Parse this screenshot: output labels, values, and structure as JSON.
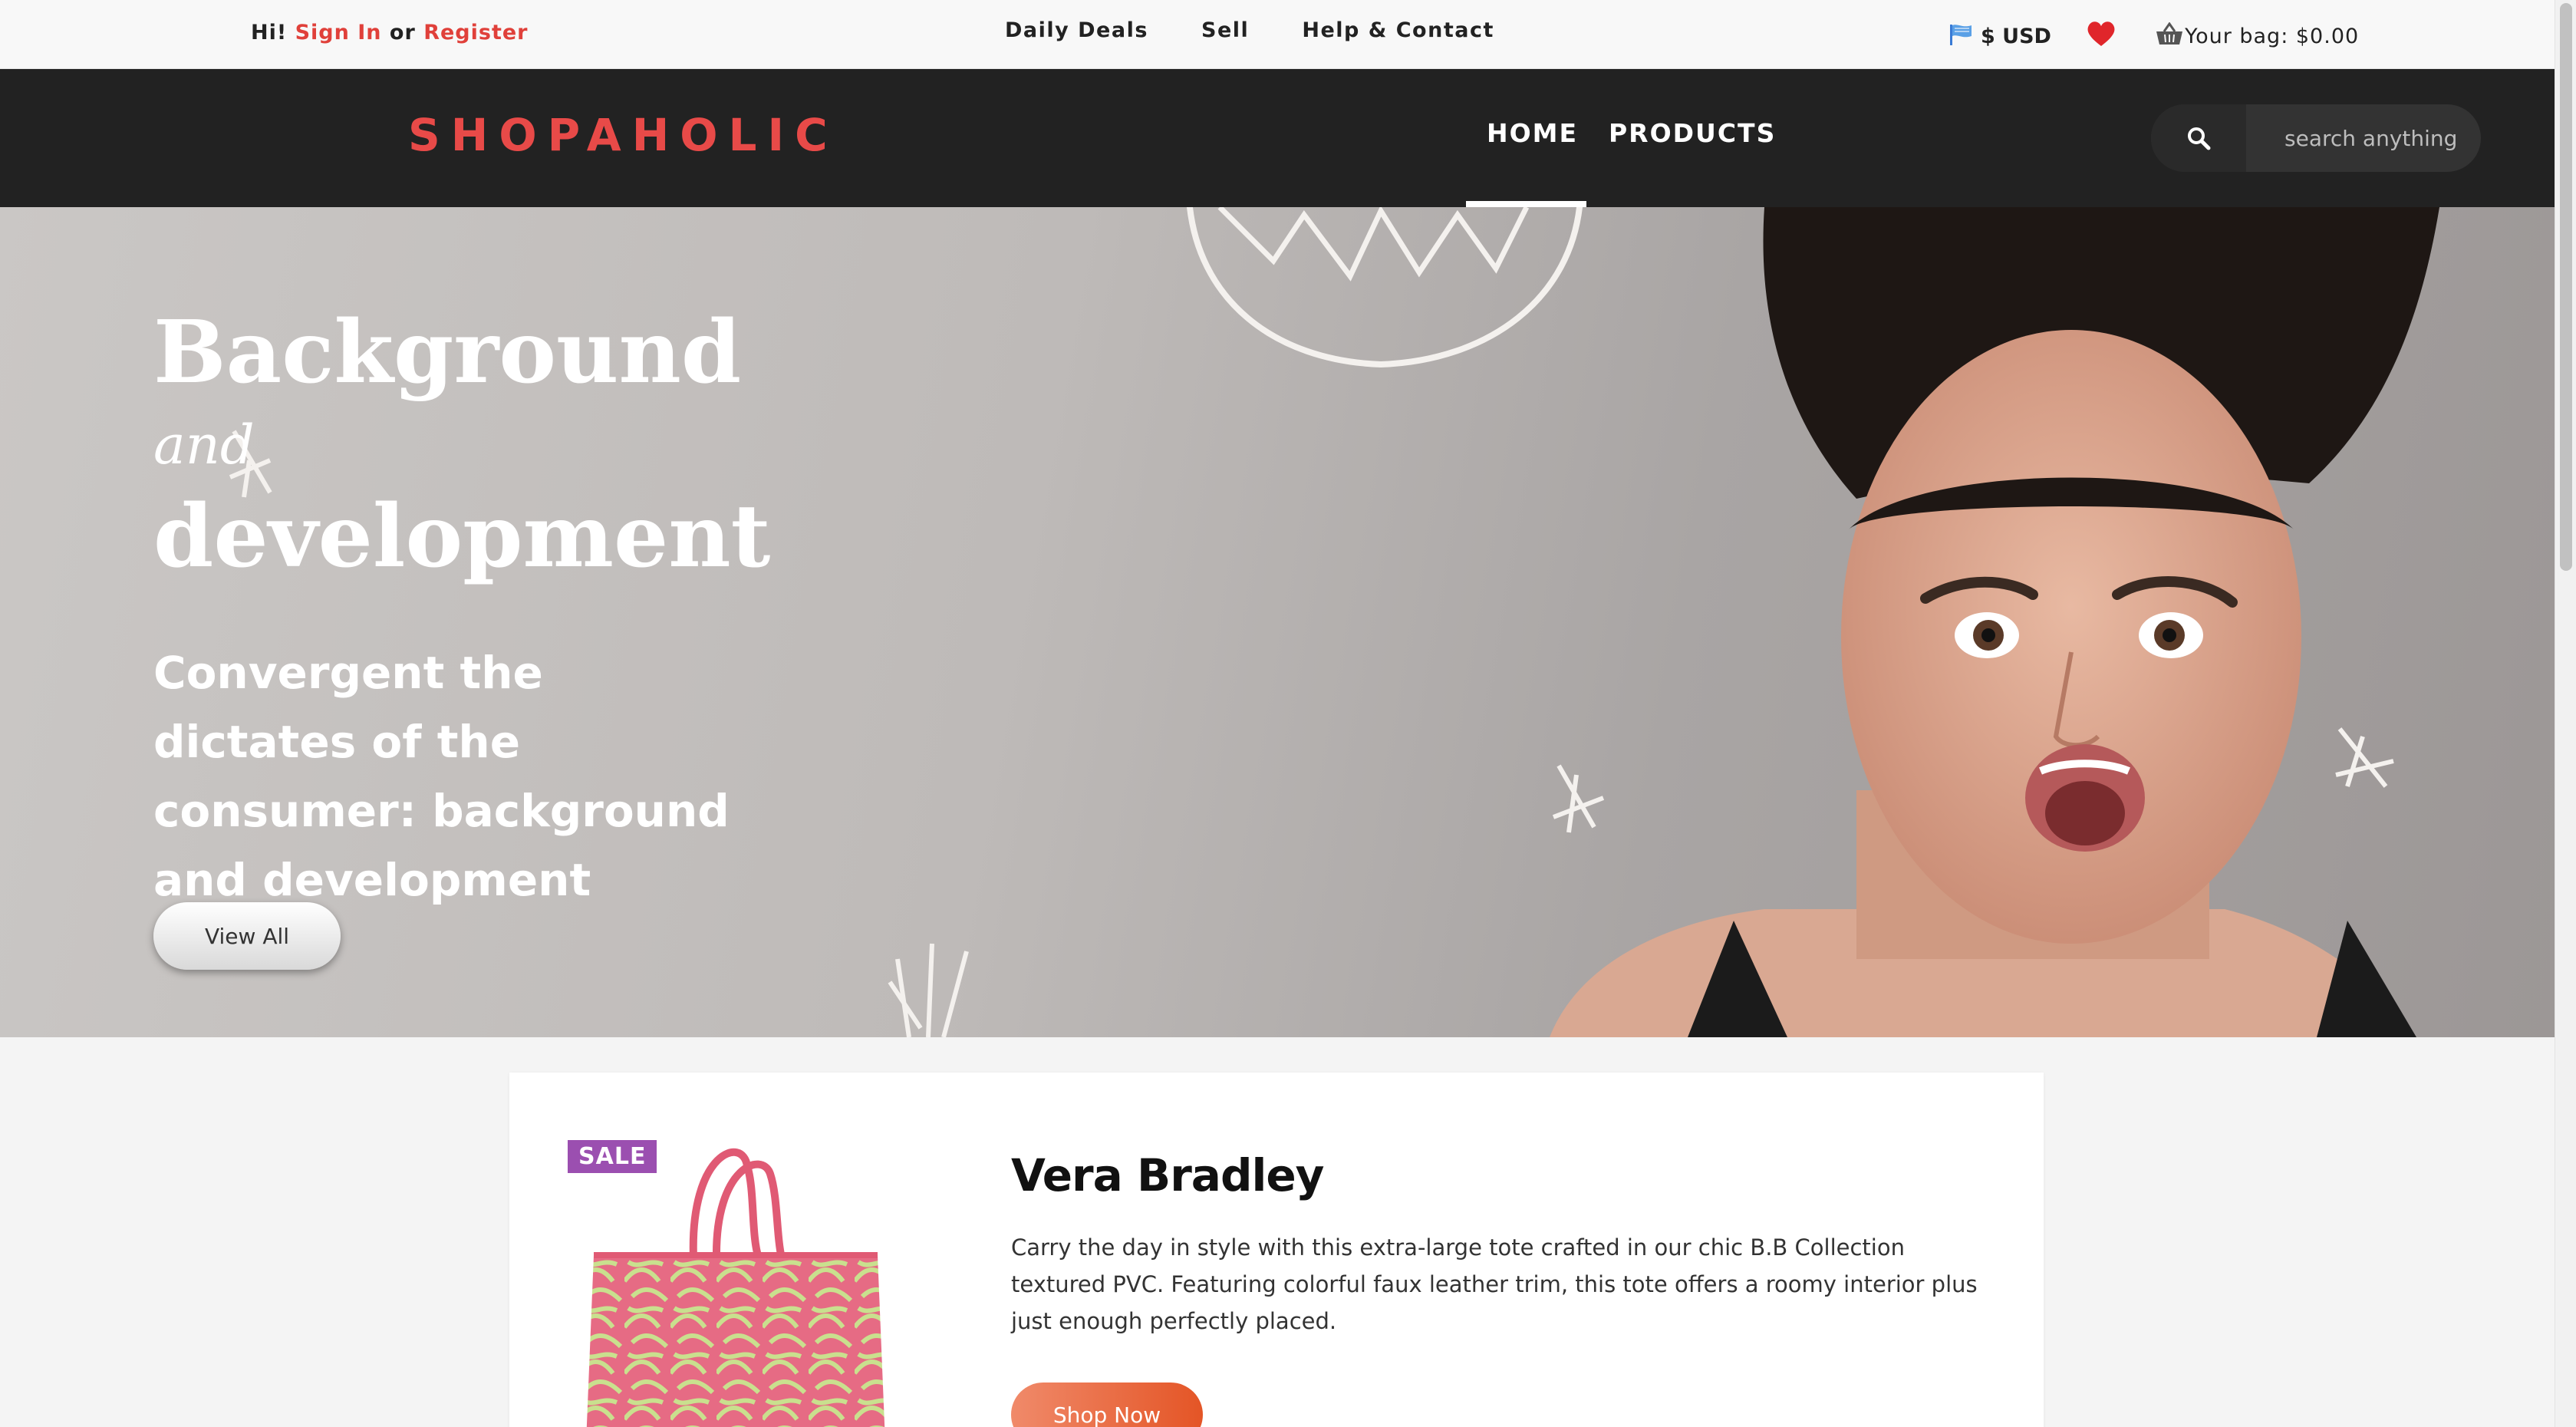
{
  "topbar": {
    "greeting_prefix": "Hi!",
    "sign_in": "Sign In",
    "or": "or",
    "register": "Register",
    "links": [
      "Daily Deals",
      "Sell",
      "Help & Contact"
    ],
    "currency": "$ USD",
    "bag": "Your bag: $0.00"
  },
  "nav": {
    "logo": "SHOPAHOLIC",
    "items": [
      "HOME",
      "PRODUCTS"
    ],
    "active": "HOME",
    "search_placeholder": "search anything"
  },
  "hero": {
    "title_line1": "Background",
    "title_and": "and",
    "title_line2": "development",
    "subtitle": "Convergent the dictates of the consumer: background and development",
    "button": "View All"
  },
  "product": {
    "badge": "SALE",
    "name": "Vera Bradley",
    "description": "Carry the day in style with this extra-large tote crafted in our chic B.B Collection textured PVC. Featuring colorful faux leather trim, this tote offers a roomy interior plus just enough perfectly placed.",
    "button": "Shop Now"
  },
  "colors": {
    "accent": "#e84a48",
    "nav_bg": "#222222",
    "sale_badge": "#9b4fb0",
    "shop_button": "#e45526"
  }
}
